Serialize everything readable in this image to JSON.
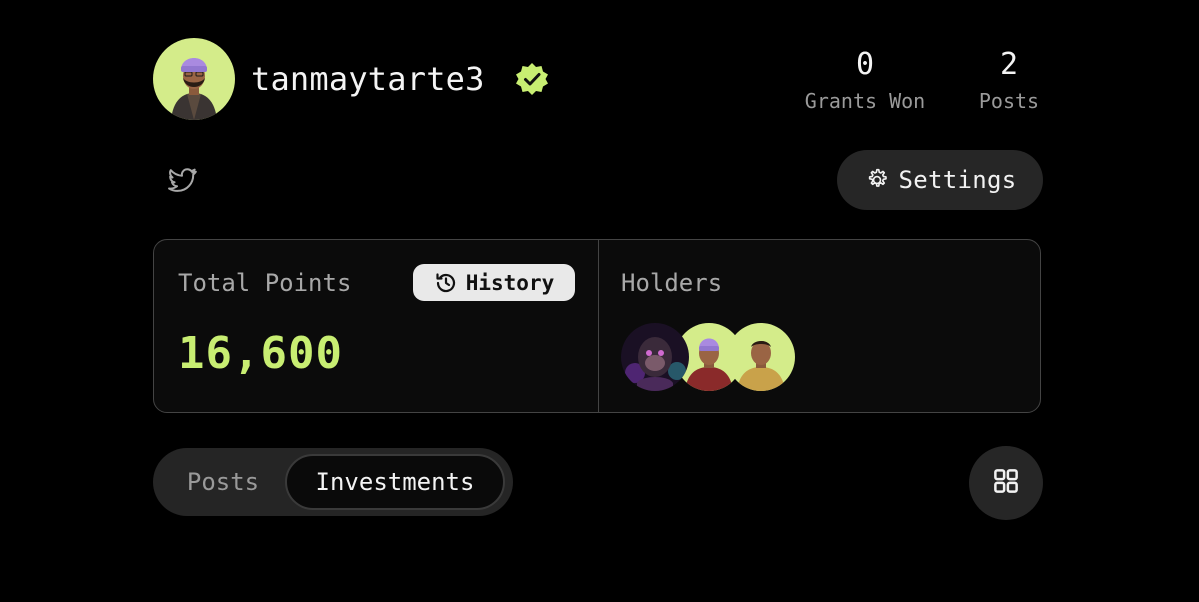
{
  "profile": {
    "username": "tanmaytarte3",
    "verified": true,
    "verified_color": "#c8ee72",
    "avatar_bg": "#d4ec8a"
  },
  "stats": {
    "grants_won_value": "0",
    "grants_won_label": "Grants Won",
    "posts_value": "2",
    "posts_label": "Posts"
  },
  "social": {
    "twitter_icon": "twitter-icon"
  },
  "settings": {
    "label": "Settings",
    "icon": "gear-icon"
  },
  "points_card": {
    "total_label": "Total Points",
    "history_label": "History",
    "history_icon": "history-icon",
    "points_value": "16,600",
    "points_color": "#c8ee72",
    "holders_label": "Holders",
    "holders_count_shown": 3
  },
  "tabs": {
    "posts_label": "Posts",
    "investments_label": "Investments",
    "active": "Investments"
  },
  "view_toggle": {
    "icon": "grid-icon"
  }
}
